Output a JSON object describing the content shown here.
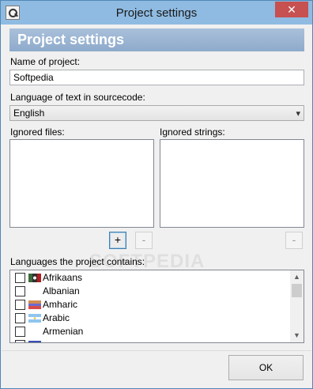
{
  "window": {
    "title": "Project settings",
    "close_glyph": "✕"
  },
  "banner": {
    "text": "Project settings"
  },
  "project_name": {
    "label": "Name of project:",
    "value": "Softpedia"
  },
  "source_language": {
    "label": "Language of text in sourcecode:",
    "selected": "English",
    "arrow_glyph": "▾"
  },
  "ignored_files": {
    "label": "Ignored files:",
    "add_label": "+",
    "remove_label": "-"
  },
  "ignored_strings": {
    "label": "Ignored strings:",
    "remove_label": "-"
  },
  "languages": {
    "label": "Languages the project contains:",
    "items": [
      {
        "name": "Afrikaans",
        "flag": "afrikaans",
        "checked": false
      },
      {
        "name": "Albanian",
        "flag": "none",
        "checked": false
      },
      {
        "name": "Amharic",
        "flag": "amharic",
        "checked": false
      },
      {
        "name": "Arabic",
        "flag": "arabic",
        "checked": false
      },
      {
        "name": "Armenian",
        "flag": "none",
        "checked": false
      }
    ],
    "scroll_up_glyph": "▲",
    "scroll_down_glyph": "▼"
  },
  "footer": {
    "ok_label": "OK"
  },
  "watermark": {
    "text": "SOFTPEDIA"
  },
  "colors": {
    "titlebar": "#8fbbe2",
    "close_button": "#c75050",
    "banner": "#9bb5d3"
  }
}
